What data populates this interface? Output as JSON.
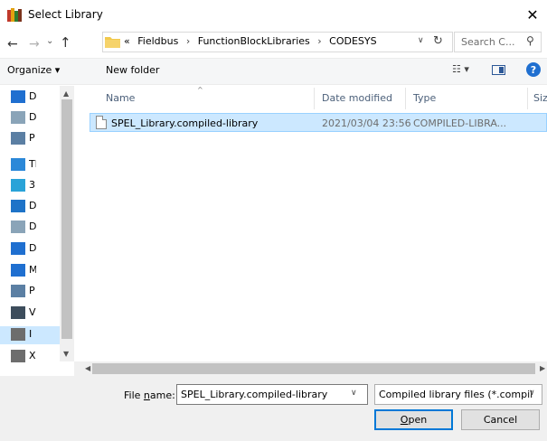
{
  "window": {
    "title": "Select Library"
  },
  "address": {
    "crumbs_prefix": "«",
    "crumbs": [
      "Fieldbus",
      "FunctionBlockLibraries",
      "CODESYS"
    ],
    "separator": "›",
    "search_placeholder": "Search C..."
  },
  "toolbar": {
    "organize_label": "Organize ▾",
    "new_folder_label": "New folder"
  },
  "nav_pane": {
    "items": [
      {
        "label": "D",
        "icon": "downloads-icon"
      },
      {
        "label": "D",
        "icon": "documents-icon"
      },
      {
        "label": "P",
        "icon": "pictures-icon"
      },
      {
        "label": "Th",
        "icon": "this-pc-icon"
      },
      {
        "label": "3",
        "icon": "3d-objects-icon"
      },
      {
        "label": "D",
        "icon": "desktop-icon"
      },
      {
        "label": "D",
        "icon": "documents-icon"
      },
      {
        "label": "D",
        "icon": "downloads-icon"
      },
      {
        "label": "M",
        "icon": "music-icon"
      },
      {
        "label": "P",
        "icon": "pictures-icon"
      },
      {
        "label": "V",
        "icon": "videos-icon"
      },
      {
        "label": "I",
        "icon": "drive-icon"
      },
      {
        "label": "X",
        "icon": "drive-icon"
      }
    ]
  },
  "file_list": {
    "columns": [
      "Name",
      "Date modified",
      "Type",
      "Size"
    ],
    "rows": [
      {
        "name": "SPEL_Library.compiled-library",
        "date": "2021/03/04 23:56",
        "type": "COMPILED-LIBRA..."
      }
    ]
  },
  "bottom": {
    "filename_label_pre": "File ",
    "filename_label_u": "n",
    "filename_label_post": "ame:",
    "filename_value": "SPEL_Library.compiled-library",
    "filetype_value": "Compiled library files (*.compil",
    "open_label_u": "O",
    "open_label_post": "pen",
    "cancel_label": "Cancel"
  },
  "colors": {
    "selection": "#cce8ff",
    "accent": "#0078d7"
  }
}
